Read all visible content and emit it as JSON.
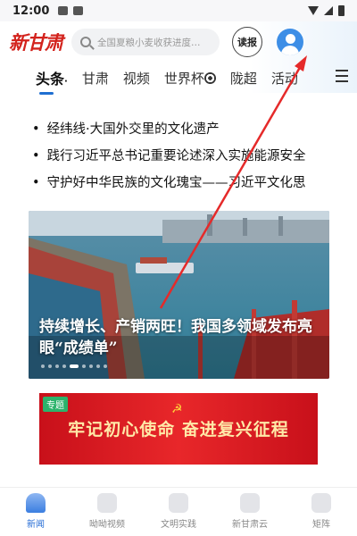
{
  "status_bar": {
    "time": "12:00"
  },
  "header": {
    "logo_text": "新甘肃",
    "search_placeholder": "全国夏粮小麦收获进度…",
    "read_button": "读报"
  },
  "tabs": [
    {
      "label": "头条",
      "active": true
    },
    {
      "label": "甘肃"
    },
    {
      "label": "视频"
    },
    {
      "label": "世界杯"
    },
    {
      "label": "陇超"
    },
    {
      "label": "活动"
    }
  ],
  "headlines": [
    "经纬线·大国外交里的文化遗产",
    "践行习近平总书记重要论述深入实施能源安全",
    "守护好中华民族的文化瑰宝——习近平文化思"
  ],
  "hero": {
    "title": "持续增长、产销两旺！我国多领域发布亮眼“成绩单”",
    "slide_count": 9,
    "active_slide": 4
  },
  "special": {
    "tag": "专题",
    "slogan": "牢记初心使命  奋进复兴征程",
    "emblem": "☭"
  },
  "bottom_nav": [
    {
      "label": "新闻",
      "active": true
    },
    {
      "label": "呦呦视频"
    },
    {
      "label": "文明实践"
    },
    {
      "label": "新甘肃云"
    },
    {
      "label": "矩阵"
    }
  ],
  "colors": {
    "brand_red": "#d3231d",
    "accent_blue": "#1f6fd1",
    "annotation_red": "#e52a2a"
  }
}
